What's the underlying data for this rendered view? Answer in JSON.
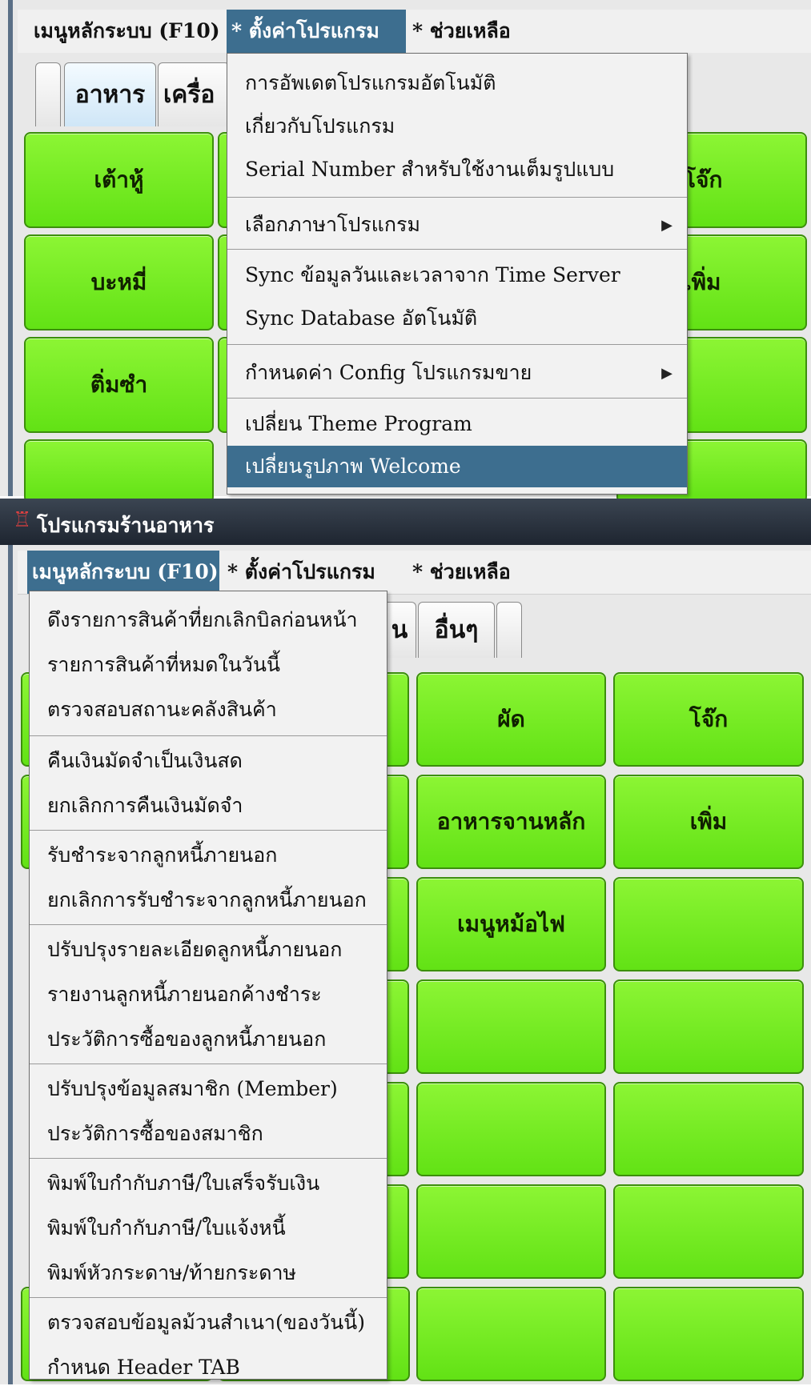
{
  "top": {
    "menubar": {
      "items": [
        "เมนูหลักระบบ (F10)",
        "* ตั้งค่าโปรแกรม",
        "* ช่วยเหลือ"
      ]
    },
    "tabs": [
      "",
      "อาหาร",
      "เครื่อ"
    ],
    "buttons": [
      "เต้าหู้",
      "โจ๊ก",
      "บะหมี่",
      "เพิ่ม",
      "ติ่มซำ"
    ],
    "settings_menu": {
      "items": [
        "การอัพเดตโปรแกรมอัตโนมัติ",
        "เกี่ยวกับโปรแกรม",
        "Serial Number สำหรับใช้งานเต็มรูปแบบ",
        "เลือกภาษาโปรแกรม",
        "Sync ข้อมูลวันและเวลาจาก Time Server",
        "Sync Database อัตโนมัติ",
        "กำหนดค่า Config โปรแกรมขาย",
        "เปลี่ยน Theme Program",
        "เปลี่ยนรูปภาพ Welcome"
      ],
      "highlighted_item": "เปลี่ยนรูปภาพ Welcome"
    }
  },
  "bottom": {
    "window_title": "โปรแกรมร้านอาหาร",
    "menubar": {
      "items": [
        "เมนูหลักระบบ (F10)",
        "* ตั้งค่าโปรแกรม",
        "* ช่วยเหลือ"
      ]
    },
    "tabs": [
      "น",
      "อื่นๆ",
      ""
    ],
    "buttons": [
      "ผัด",
      "โจ๊ก",
      "อาหารจานหลัก",
      "เพิ่ม",
      "เมนูหม้อไฟ"
    ],
    "main_menu": {
      "items": [
        "ดึงรายการสินค้าที่ยกเลิกบิลก่อนหน้า",
        "รายการสินค้าที่หมดในวันนี้",
        "ตรวจสอบสถานะคลังสินค้า",
        "คืนเงินมัดจำเป็นเงินสด",
        "ยกเลิกการคืนเงินมัดจำ",
        "รับชำระจากลูกหนี้ภายนอก",
        "ยกเลิกการรับชำระจากลูกหนี้ภายนอก",
        "ปรับปรุงรายละเอียดลูกหนี้ภายนอก",
        "รายงานลูกหนี้ภายนอกค้างชำระ",
        "ประวัติการซื้อของลูกหนี้ภายนอก",
        "ปรับปรุงข้อมูลสมาชิก (Member)",
        "ประวัติการซื้อของสมาชิก",
        "พิมพ์ใบกำกับภาษี/ใบเสร็จรับเงิน",
        "พิมพ์ใบกำกับภาษี/ใบแจ้งหนี้",
        "พิมพ์หัวกระดาษ/ท้ายกระดาษ",
        "ตรวจสอบข้อมูลม้วนสำเนา(ของวันนี้)",
        "กำหนด Header TAB"
      ]
    }
  },
  "colors": {
    "menu_highlight": "#3d6e8f",
    "button_green": "#74ea22",
    "titlebar": "#2a323d"
  }
}
